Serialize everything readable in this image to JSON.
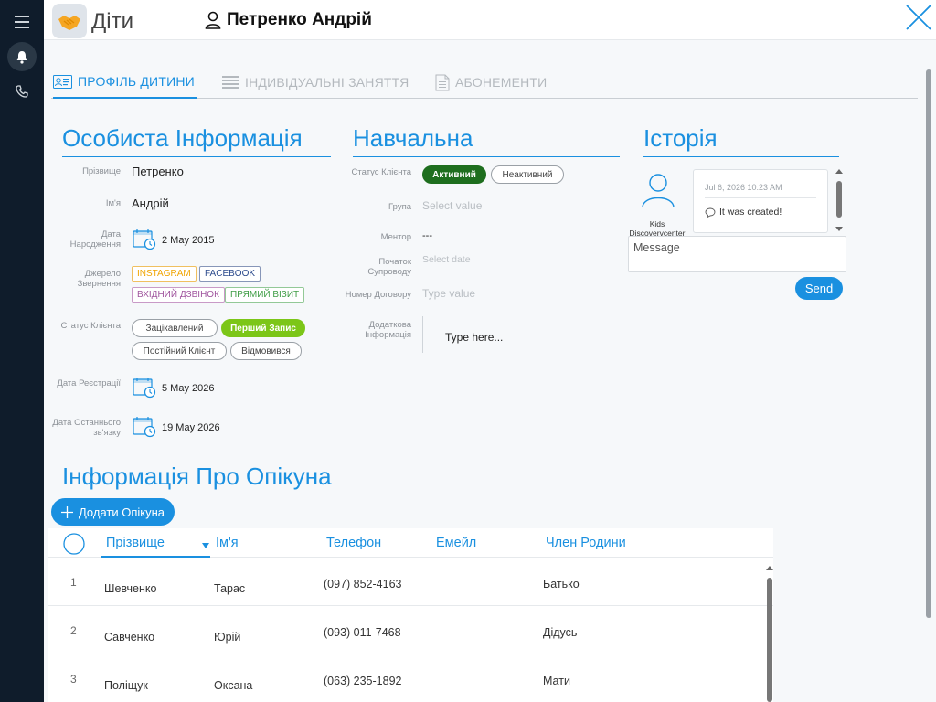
{
  "header": {
    "app_name": "Діти",
    "child_name": "Петренко Андрій"
  },
  "tabs": [
    {
      "label": "ПРОФІЛЬ ДИТИНИ"
    },
    {
      "label": "ІНДИВІДУАЛЬНІ ЗАНЯТТЯ"
    },
    {
      "label": "АБОНЕМЕНТИ"
    }
  ],
  "personal": {
    "title": "Особиста Інформація",
    "surname_label": "Прізвище",
    "surname": "Петренко",
    "name_label": "Ім'я",
    "name": "Андрій",
    "birth_label": "Дата Народження",
    "birth_date": "2 May 2015",
    "source_label": "Джерело Звернення",
    "sources": [
      "INSTAGRAM",
      "FACEBOOK",
      "ВХІДНИЙ ДЗВІНОК",
      "ПРЯМИЙ ВІЗИТ"
    ],
    "status_label": "Статус Клієнта",
    "statuses": [
      "Зацікавлений",
      "Перший Запис",
      "Постійний Клієнт",
      "Відмовився"
    ],
    "reg_label": "Дата Реєстрації",
    "reg_date": "5 May 2026",
    "last_label": "Дата Останнього зв'язку",
    "last_date": "19 May 2026"
  },
  "education": {
    "title": "Навчальна",
    "status_label": "Статус Клієнта",
    "status_active": "Активний",
    "status_inactive": "Неактивний",
    "group_label": "Група",
    "group_placeholder": "Select value",
    "mentor_label": "Ментор",
    "mentor": "---",
    "start_label": "Початок Супроводу",
    "start_placeholder": "Select date",
    "contract_label": "Номер Договору",
    "contract_placeholder": "Type value",
    "extra_label": "Додаткова Інформація",
    "extra_placeholder": "Type here..."
  },
  "history": {
    "title": "Історія",
    "author": "Kids Discovervcenter",
    "entry_date": "Jul 6, 2026 10:23 AM",
    "entry_text": "It was created!",
    "message_placeholder": "Message",
    "send_label": "Send"
  },
  "guardian": {
    "title": "Інформація Про Опікуна",
    "add_label": "Додати Опікуна",
    "columns": [
      "Прізвище",
      "Ім'я",
      "Телефон",
      "Емейл",
      "Член Родини"
    ],
    "rows": [
      {
        "idx": "1",
        "surname": "Шевченко",
        "name": "Тарас",
        "phone": "(097) 852-4163",
        "email": "",
        "relation": "Батько"
      },
      {
        "idx": "2",
        "surname": "Савченко",
        "name": "Юрій",
        "phone": "(093) 011-7468",
        "email": "",
        "relation": "Дідусь"
      },
      {
        "idx": "3",
        "surname": "Поліщук",
        "name": "Оксана",
        "phone": "(063) 235-1892",
        "email": "",
        "relation": "Мати"
      }
    ]
  },
  "colors": {
    "accent": "#1a90e0",
    "rail": "#0f1c2b",
    "instagram": "#f0a400",
    "facebook": "#2b4a8c",
    "incoming_call": "#a0559e",
    "direct_visit": "#3f9d45",
    "active_status": "#1e6e1e",
    "first_booking": "#7cc618"
  }
}
